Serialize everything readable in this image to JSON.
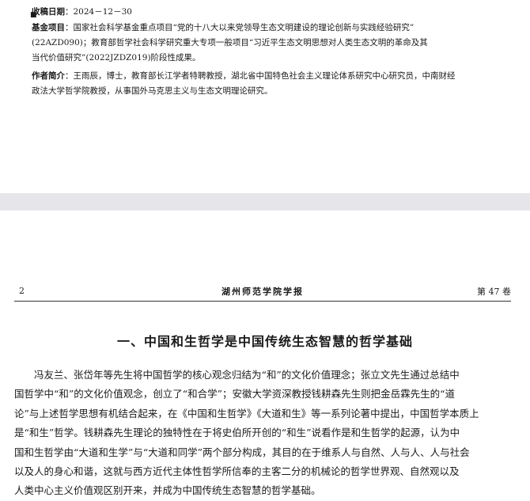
{
  "footnote": {
    "received_label": "收稿日期",
    "received_value": "：2024－12－30",
    "fund_label": "基金项目",
    "fund_lines": [
      "：国家社会科学基金重点项目“党的十八大以来党领导生态文明建设的理论创新与实践经验研究”",
      "(22AZD090)；教育部哲学社会科学研究重大专项一般项目“习近平生态文明思想对人类生态文明的革命及其",
      "当代价值研究”(2022JZDZ019)阶段性成果。"
    ],
    "author_label": "作者简介",
    "author_lines": [
      "：王雨辰，博士，教育部长江学者特聘教授，湖北省中国特色社会主义理论体系研究中心研究员，中南财经",
      "政法大学哲学院教授，从事国外马克思主义与生态文明理论研究。"
    ]
  },
  "header": {
    "page_number": "2",
    "journal": "湖州师范学院学报",
    "volume": "第 47 卷"
  },
  "section_title": "一、中国和生哲学是中国传统生态智慧的哲学基础",
  "body_lines": [
    "　　冯友兰、张岱年等先生将中国哲学的核心观念归结为“和”的文化价值理念；张立文先生通过总结中",
    "国哲学中“和”的文化价值观念，创立了“和合学”；安徽大学资深教授钱耕森先生则把金岳霖先生的“道",
    "论”与上述哲学思想有机结合起来，在《中国和生哲学》《大道和生》等一系列论著中提出，中国哲学本质上",
    "是“和生”哲学。钱耕森先生理论的独特性在于将史伯所开创的“和生”说看作是和生哲学的起源，认为中",
    "国和生哲学由“大道和生学”与“大道和同学”两个部分构成，其目的在于维系人与自然、人与人、人与社会",
    "以及人的身心和谐，这就与西方近代主体性哲学所信奉的主客二分的机械论的哲学世界观、自然观以及",
    "人类中心主义价值观区别开来，并成为中国传统生态智慧的哲学基础。"
  ]
}
